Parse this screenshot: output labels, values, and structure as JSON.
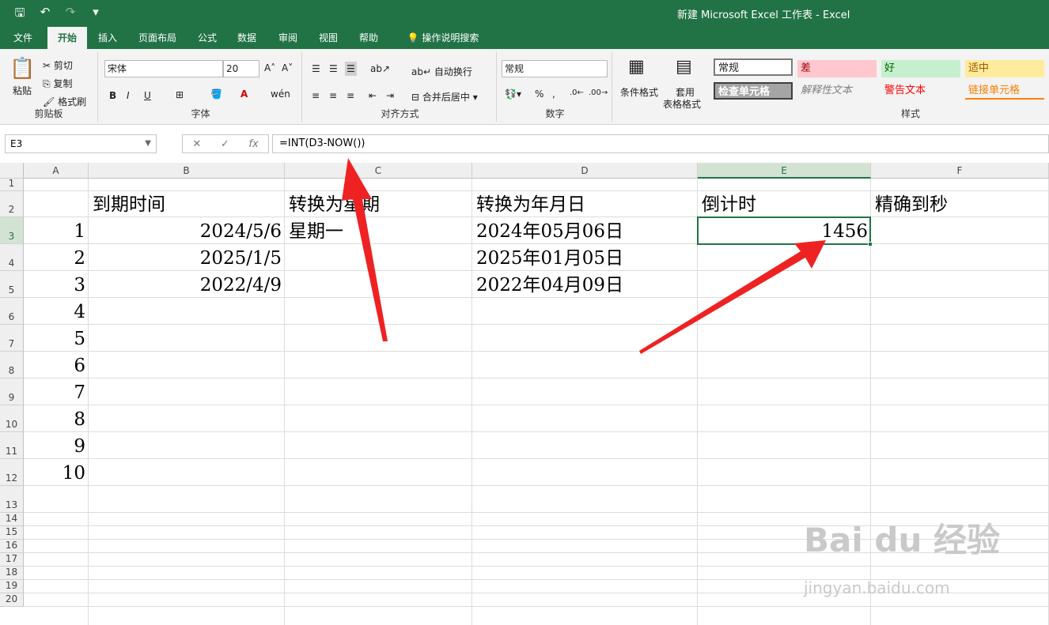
{
  "window": {
    "title": "新建 Microsoft Excel 工作表  -  Excel"
  },
  "qat": {
    "save": "🖫",
    "undo": "↶",
    "redo": "↷",
    "customize": "▾"
  },
  "tabs": [
    "文件",
    "开始",
    "插入",
    "页面布局",
    "公式",
    "数据",
    "审阅",
    "视图",
    "帮助"
  ],
  "tellme": "操作说明搜索",
  "ribbon": {
    "clipboard": {
      "label": "剪贴板",
      "paste": "粘贴",
      "cut": "剪切",
      "copy": "复制",
      "format_painter": "格式刷"
    },
    "font": {
      "label": "字体",
      "name": "宋体",
      "size": "20",
      "bold": "B",
      "italic": "I",
      "underline": "U"
    },
    "align": {
      "label": "对齐方式",
      "wrap": "自动换行",
      "merge": "合并后居中"
    },
    "number": {
      "label": "数字",
      "format": "常规",
      "percent": "%",
      "comma": ","
    },
    "cond": {
      "cond_format": "条件格式",
      "table_format_l1": "套用",
      "table_format_l2": "表格格式"
    },
    "styles": {
      "label": "样式",
      "normal": "常规",
      "bad": "差",
      "good": "好",
      "neutral": "适中",
      "check": "检查单元格",
      "explanatory": "解释性文本",
      "warning": "警告文本",
      "linked": "链接单元格"
    }
  },
  "formula_bar": {
    "name_box": "E3",
    "formula": "=INT(D3-NOW())",
    "fx": "fx"
  },
  "columns": [
    "A",
    "B",
    "C",
    "D",
    "E",
    "F"
  ],
  "rows": [
    "1",
    "2",
    "3",
    "4",
    "5",
    "6",
    "7",
    "8",
    "9",
    "10",
    "11",
    "12",
    "13",
    "14",
    "15",
    "16",
    "17",
    "18",
    "19",
    "20"
  ],
  "cells": {
    "B2": "到期时间",
    "C2": "转换为星期",
    "D2": "转换为年月日",
    "E2": "倒计时",
    "F2": "精确到秒",
    "A3": "1",
    "B3": "2024/5/6",
    "C3": "星期一",
    "D3": "2024年05月06日",
    "E3": "1456",
    "A4": "2",
    "B4": "2025/1/5",
    "D4": "2025年01月05日",
    "A5": "3",
    "B5": "2022/4/9",
    "D5": "2022年04月09日",
    "A6": "4",
    "A7": "5",
    "A8": "6",
    "A9": "7",
    "A10": "8",
    "A11": "9",
    "A12": "10"
  },
  "watermark": {
    "brand": "Bai du 经验",
    "url": "jingyan.baidu.com"
  },
  "colors": {
    "excel_green": "#217346",
    "arrow_red": "#ee2222"
  }
}
